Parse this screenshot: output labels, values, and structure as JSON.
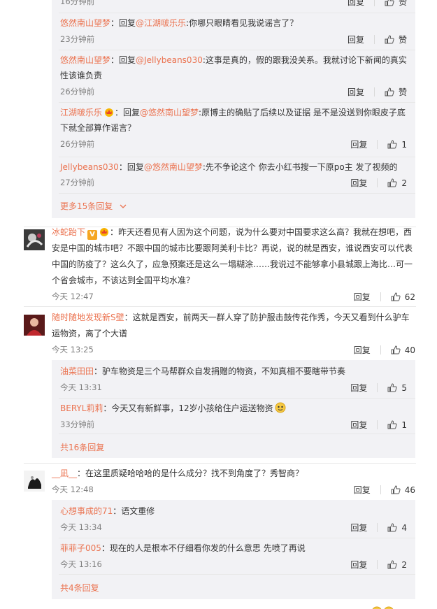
{
  "thread1": {
    "replies": [
      {
        "time": "16分钟前",
        "reply_label": "回复",
        "like_label": "赞"
      },
      {
        "user": "悠然南山望梦",
        "prefix": "：回复",
        "mention": "@江湖啵乐乐",
        "text": ":你哪只眼睛看见我说谣言了？",
        "time": "23分钟前",
        "reply_label": "回复",
        "like_label": "赞"
      },
      {
        "user": "悠然南山望梦",
        "prefix": "：回复",
        "mention": "@Jellybeans030",
        "text": ":这事是真的，假的跟我没关系。我就讨论下新闻的真实性该谁负责",
        "time": "26分钟前",
        "reply_label": "回复",
        "like_label": "赞"
      },
      {
        "user": "江湖啵乐乐",
        "prefix": "：回复",
        "mention": "@悠然南山望梦",
        "text": ":原博主的确贴了后续以及证据 是不是没送到你眼皮子底下就全部算作谣言？",
        "time": "26分钟前",
        "reply_label": "回复",
        "like_count": "1"
      },
      {
        "user": "Jellybeans030",
        "prefix": "：回复",
        "mention": "@悠然南山望梦",
        "text": ":先不争论这个 你去小红书搜一下原po主 发了视频的",
        "time": "27分钟前",
        "reply_label": "回复",
        "like_count": "2"
      }
    ],
    "more_label": "更多15条回复"
  },
  "comment2": {
    "user": "冰蛇跆下",
    "text": "：昨天还看见有人因为这个问题，说为什么要对中国要求这么高？我就在想吧，西安是中国的城市吧？不跟中国的城市比要跟阿美利卡比？再说，说的就是西安，谁说西安可以代表中国的防疫了？这么久了，应急预案还是这么一塌糊涂……我说过不能够拿小县城跟上海比…可一个省会城市，不该达到全国平均水准？",
    "time": "今天 12:47",
    "reply_label": "回复",
    "like_count": "62"
  },
  "comment3": {
    "user": "随时随地发现新S壁",
    "text": "：这就是西安，前两天一群人穿了防护服击鼓传花作秀，今天又看到什么驴车运物资，离了个大谱",
    "time": "今天 13:25",
    "reply_label": "回复",
    "like_count": "40",
    "replies": [
      {
        "user": "油菜田田",
        "text": "：驴车物资是三个马帮群众自发捐赠的物资，不知真相不要瞎带节奏",
        "time": "今天 13:31",
        "reply_label": "回复",
        "like_count": "5"
      },
      {
        "user": "BERYL莉莉",
        "text": "：今天又有新鲜事，12岁小孩给住户运送物资",
        "time": "33分钟前",
        "reply_label": "回复",
        "like_count": "1"
      }
    ],
    "more_label": "共16条回复"
  },
  "comment4": {
    "user": "__凪__",
    "text": "：在这里质疑哈哈哈的是什么成分？找不到角度了？秀智商？",
    "time": "今天 12:48",
    "reply_label": "回复",
    "like_count": "46",
    "replies": [
      {
        "user": "心想事成的71",
        "text": "：语文重修",
        "time": "今天 13:34",
        "reply_label": "回复",
        "like_count": "4"
      },
      {
        "user": "菲菲子005",
        "text": "：现在的人是根本不仔细看你发的什么意思 先喷了再说",
        "time": "今天 13:16",
        "reply_label": "回复",
        "like_count": "2"
      }
    ],
    "more_label": "共4条回复"
  },
  "colors": {
    "username": "#eb7350",
    "time": "#808080",
    "reply_bg": "#f2f2f5"
  }
}
